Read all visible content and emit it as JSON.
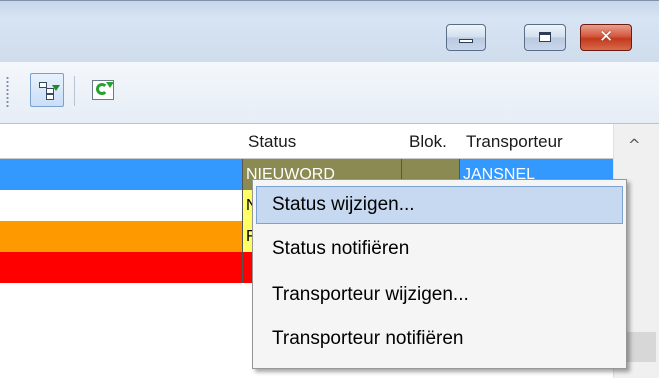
{
  "window": {
    "controls": {
      "minimize_icon": "minimize-icon",
      "maximize_icon": "maximize-icon",
      "close_icon": "close-icon",
      "close_glyph": "✕"
    }
  },
  "toolbar": {
    "buttons": [
      {
        "icon": "tree-view-icon"
      },
      {
        "icon": "refresh-icon"
      }
    ]
  },
  "grid": {
    "columns": [
      "Status",
      "Blok.",
      "Transporteur"
    ],
    "rows": [
      {
        "color": "#3399ff",
        "status": "NIEUWORD",
        "blok": "",
        "transporteur": "JANSNEL"
      },
      {
        "color": "#ffffff",
        "status": "N",
        "blok": "",
        "transporteur": ""
      },
      {
        "color": "#ff9900",
        "status": "F",
        "blok": "",
        "transporteur": ""
      },
      {
        "color": "#ff0000",
        "status": "",
        "blok": "",
        "transporteur": ""
      }
    ],
    "scroll_up_glyph": "^"
  },
  "context_menu": {
    "items": [
      "Status wijzigen...",
      "Status notifiëren",
      "Transporteur wijzigen...",
      "Transporteur notifiëren"
    ],
    "highlighted_index": 0
  }
}
